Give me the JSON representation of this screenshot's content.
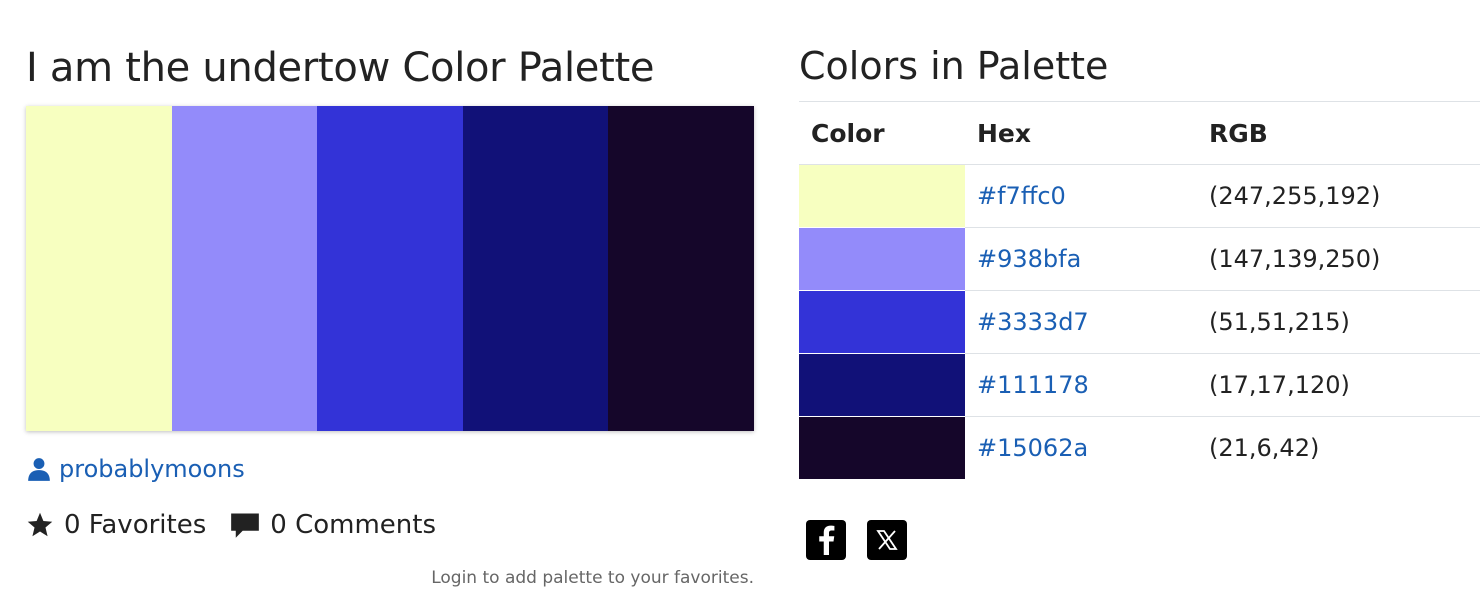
{
  "palette": {
    "title": "I am the undertow Color Palette",
    "author": "probablymoons",
    "favorites_label": "0 Favorites",
    "comments_label": "0 Comments",
    "login_note": "Login to add palette to your favorites."
  },
  "colors_section": {
    "title": "Colors in Palette",
    "headers": [
      "Color",
      "Hex",
      "RGB"
    ],
    "rows": [
      {
        "swatch": "#f7ffc0",
        "hex": "#f7ffc0",
        "rgb": "(247,255,192)"
      },
      {
        "swatch": "#938bfa",
        "hex": "#938bfa",
        "rgb": "(147,139,250)"
      },
      {
        "swatch": "#3333d7",
        "hex": "#3333d7",
        "rgb": "(51,51,215)"
      },
      {
        "swatch": "#111178",
        "hex": "#111178",
        "rgb": "(17,17,120)"
      },
      {
        "swatch": "#15062a",
        "hex": "#15062a",
        "rgb": "(21,6,42)"
      }
    ]
  },
  "icons": {
    "user": "user-icon",
    "star": "star-icon",
    "comment": "comment-icon",
    "facebook": "facebook-icon",
    "x": "x-icon"
  },
  "theme": {
    "link": "#1a5fb4",
    "text": "#222222",
    "muted": "#666666"
  }
}
